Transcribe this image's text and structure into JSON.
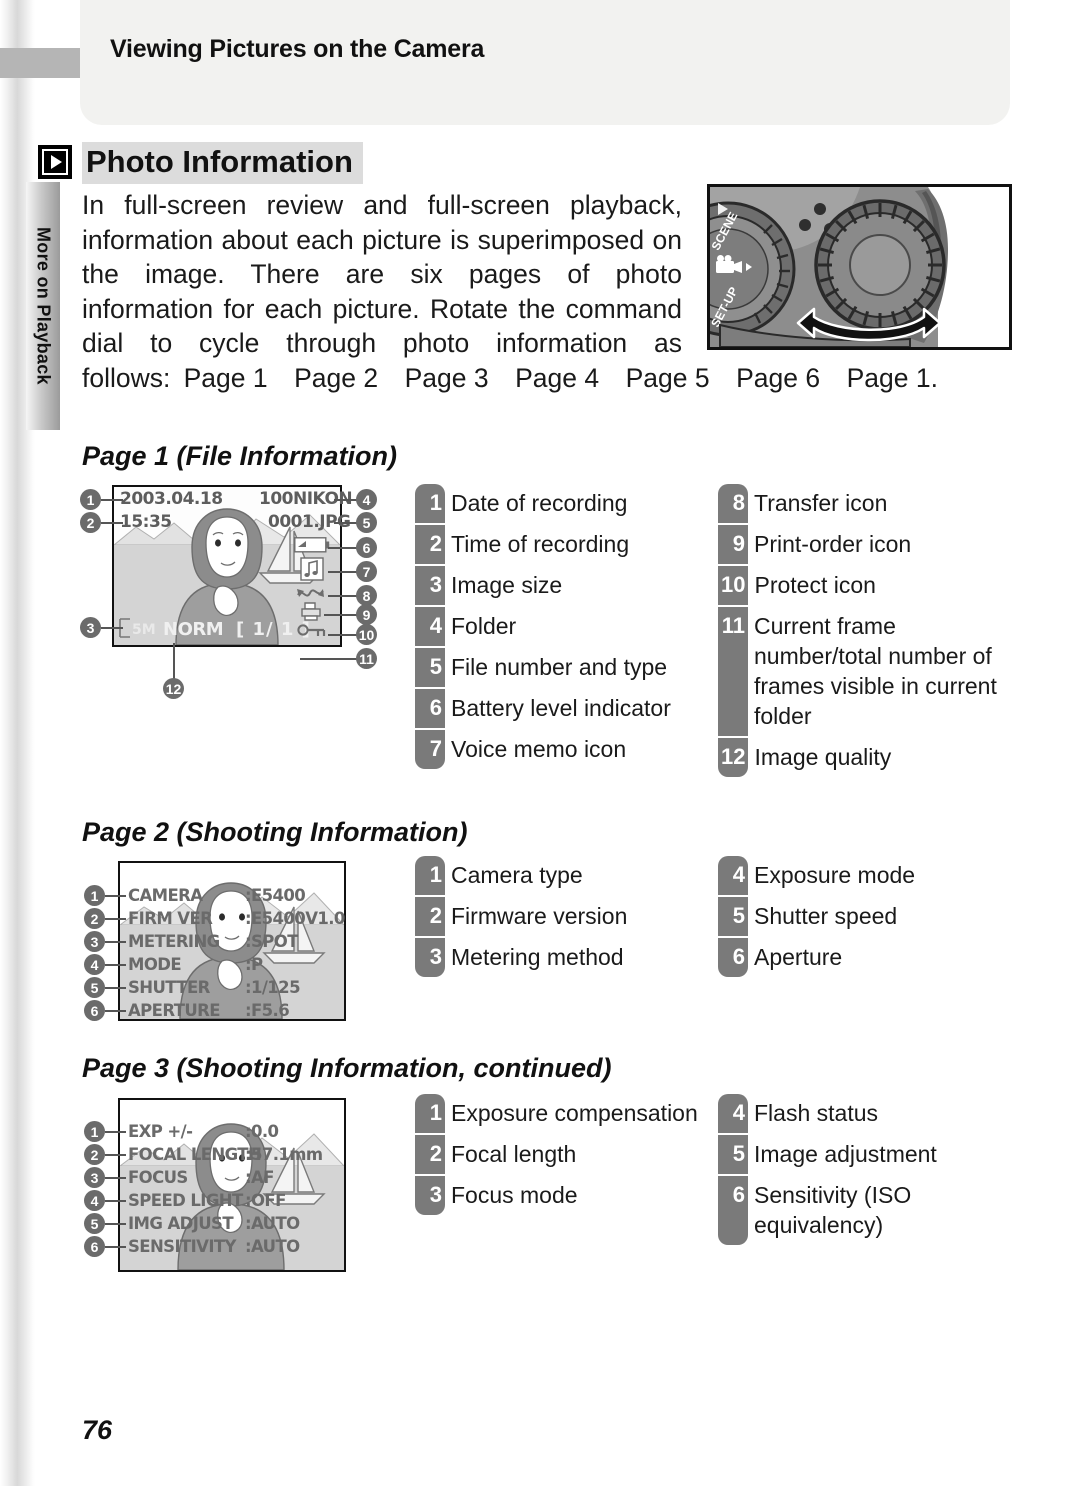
{
  "header": {
    "title": "Viewing Pictures on the Camera",
    "chapter_tab": "More on Playback"
  },
  "section": {
    "icon": "playback-icon",
    "title": "Photo Information",
    "body_part1": "In full-screen review and full-screen playback, information about each picture is superimposed on the image.  There are six pages of photo information for each picture.  Rotate the command dial to cycle through photo information as follows:",
    "body_pages": [
      "Page 1",
      "Page 2",
      "Page 3",
      "Page 4",
      "Page 5",
      "Page 6",
      "Page 1."
    ]
  },
  "camera_figure": {
    "name": "command-dial-illustration",
    "dial_labels": [
      "SCENE",
      "SET-UP"
    ],
    "movie_icon": "movie-camera-icon",
    "rotate_arrow": "double-headed-rotation-arrow"
  },
  "page1": {
    "title": "Page 1 (File Information)",
    "lcd": {
      "date": "2003.04.18",
      "time": "15:35",
      "folder": "100NIKON",
      "file": "0001.JPG",
      "battery_icon": "battery-level-icon",
      "voice_icon": "voice-memo-icon",
      "transfer_icon": "transfer-icon",
      "print_icon": "print-order-icon",
      "protect_icon": "protect-key-icon",
      "size_badge": "5M",
      "quality": "NORM",
      "frame_counter": "[    1/    1 ]"
    },
    "legend_left": [
      {
        "num": "1",
        "label": "Date of recording"
      },
      {
        "num": "2",
        "label": "Time of recording"
      },
      {
        "num": "3",
        "label": "Image size"
      },
      {
        "num": "4",
        "label": "Folder"
      },
      {
        "num": "5",
        "label": "File number and type"
      },
      {
        "num": "6",
        "label": "Battery level indicator"
      },
      {
        "num": "7",
        "label": "Voice memo icon"
      }
    ],
    "legend_right": [
      {
        "num": "8",
        "label": "Transfer icon"
      },
      {
        "num": "9",
        "label": "Print-order icon"
      },
      {
        "num": "10",
        "label": "Protect icon"
      },
      {
        "num": "11",
        "label": "Current frame number/total number of frames visible in current folder"
      },
      {
        "num": "12",
        "label": "Image quality"
      }
    ]
  },
  "page2": {
    "title": "Page 2 (Shooting Information)",
    "lcd_rows": [
      {
        "label": "CAMERA",
        "value": ":E5400"
      },
      {
        "label": "FIRM VER",
        "value": ":E5400V1.0"
      },
      {
        "label": "METERING",
        "value": ":SPOT"
      },
      {
        "label": "MODE",
        "value": ":P"
      },
      {
        "label": "SHUTTER",
        "value": ":1/125"
      },
      {
        "label": "APERTURE",
        "value": ":F5.6"
      }
    ],
    "legend_left": [
      {
        "num": "1",
        "label": "Camera type"
      },
      {
        "num": "2",
        "label": "Firmware version"
      },
      {
        "num": "3",
        "label": "Metering method"
      }
    ],
    "legend_right": [
      {
        "num": "4",
        "label": "Exposure mode"
      },
      {
        "num": "5",
        "label": "Shutter speed"
      },
      {
        "num": "6",
        "label": "Aperture"
      }
    ]
  },
  "page3": {
    "title": "Page 3 (Shooting Information, continued)",
    "lcd_rows": [
      {
        "label": "EXP +/-",
        "value": ":0.0"
      },
      {
        "label": "FOCAL LENGTH",
        "value": ":57.1mm"
      },
      {
        "label": "FOCUS",
        "value": ":AF"
      },
      {
        "label": "SPEED LIGHT",
        "value": ":OFF"
      },
      {
        "label": "IMG ADJUST",
        "value": ":AUTO"
      },
      {
        "label": "SENSITIVITY",
        "value": ":AUTO"
      }
    ],
    "legend_left": [
      {
        "num": "1",
        "label": "Exposure compensation"
      },
      {
        "num": "2",
        "label": "Focal length"
      },
      {
        "num": "3",
        "label": "Focus mode"
      }
    ],
    "legend_right": [
      {
        "num": "4",
        "label": "Flash status"
      },
      {
        "num": "5",
        "label": "Image adjustment"
      },
      {
        "num": "6",
        "label": "Sensitivity (ISO equivalency)"
      }
    ]
  },
  "footer": {
    "page_number": "76"
  },
  "colors": {
    "legend_num_bg": "#7a7a7a",
    "bullet_bg": "#6b6b6b",
    "header_panel": "#f2f2f0",
    "highlight": "#dcdcdc"
  }
}
